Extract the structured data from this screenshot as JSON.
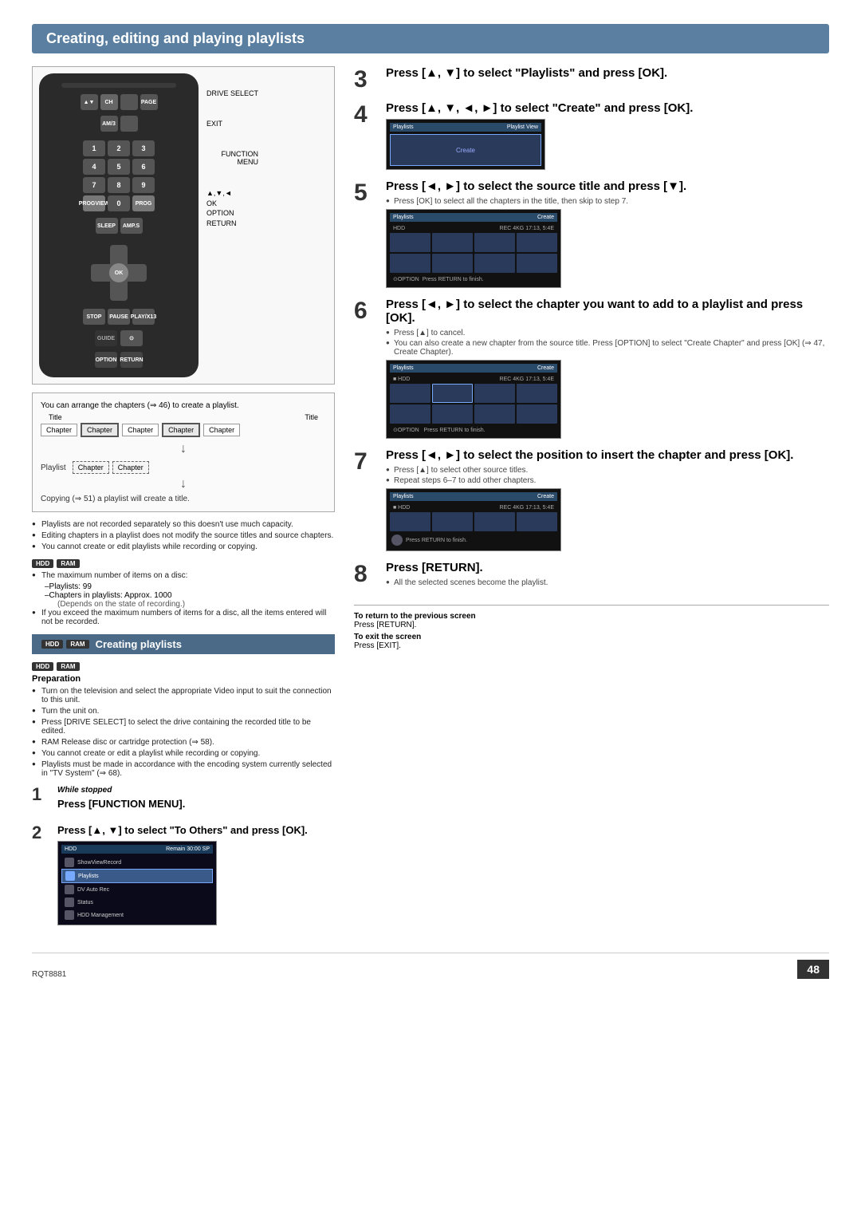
{
  "page": {
    "title": "Creating, editing and playing playlists",
    "page_number": "48",
    "doc_code": "RQT8881"
  },
  "sections": {
    "creating_playlists": {
      "header": "Creating playlists",
      "badges": [
        "HDD",
        "RAM"
      ],
      "preparation_title": "Preparation",
      "prep_notes": [
        "Turn on the television and select the appropriate Video input to suit the connection to this unit.",
        "Turn the unit on.",
        "Press [DRIVE SELECT] to select the drive containing the recorded title to be edited.",
        "RAM Release disc or cartridge protection (⇒ 58).",
        "You cannot create or edit a playlist while recording or copying.",
        "Playlists must be made in accordance with the encoding system currently selected in \"TV System\" (⇒ 68)."
      ]
    },
    "steps": [
      {
        "num": "1",
        "context": "While stopped",
        "text": "Press [FUNCTION MENU]."
      },
      {
        "num": "2",
        "text": "Press [▲, ▼] to select \"To Others\" and press [OK]."
      },
      {
        "num": "3",
        "text": "Press [▲, ▼] to select \"Playlists\" and press [OK]."
      },
      {
        "num": "4",
        "text": "Press [▲, ▼, ◄, ►] to select \"Create\" and press [OK]."
      },
      {
        "num": "5",
        "text": "Press [◄, ►] to select the source title and press [▼].",
        "notes": [
          "Press [OK] to select all the chapters in the title, then skip to step 7."
        ]
      },
      {
        "num": "6",
        "text": "Press [◄, ►] to select the chapter you want to add to a playlist and press [OK].",
        "notes": [
          "Press [▲] to cancel.",
          "You can also create a new chapter from the source title. Press [OPTION] to select \"Create Chapter\" and press [OK] (⇒ 47, Create Chapter)."
        ]
      },
      {
        "num": "7",
        "text": "Press [◄, ►] to select the position to insert the chapter and press [OK].",
        "notes": [
          "Press [▲] to select other source titles.",
          "Repeat steps 6–7 to add other chapters."
        ]
      },
      {
        "num": "8",
        "text": "Press [RETURN].",
        "notes": [
          "All the selected scenes become the playlist."
        ]
      }
    ]
  },
  "diagram": {
    "title_labels": [
      "Title",
      "Title"
    ],
    "chapter_row": [
      "Chapter",
      "Chapter",
      "Chapter",
      "Chapter",
      "Chapter"
    ],
    "playlist_label": "Playlist",
    "playlist_chapters": [
      "Chapter",
      "Chapter"
    ],
    "note": "Copying (⇒ 51) a playlist will create a title."
  },
  "general_notes": [
    "Playlists are not recorded separately so this doesn't use much capacity.",
    "Editing chapters in a playlist does not modify the source titles and source chapters.",
    "You cannot create or edit playlists while recording or copying."
  ],
  "hdd_ram_notes": {
    "badges": [
      "HDD",
      "RAM"
    ],
    "items": [
      "The maximum number of items on a disc:",
      "Playlists: 99",
      "Chapters in playlists: Approx. 1000",
      "(Depends on the state of recording.)",
      "If you exceed the maximum numbers of items for a disc, all the items entered will not be recorded."
    ]
  },
  "footer": {
    "return_label": "To return to the previous screen",
    "return_text": "Press [RETURN].",
    "exit_label": "To exit the screen",
    "exit_text": "Press [EXIT]."
  },
  "screens": {
    "function_menu": {
      "header_left": "HDD",
      "header_right": "Remain 30:00 SP",
      "items": [
        "ShowViewRecord",
        "Playlists",
        "DV Auto Rec",
        "Status",
        "HDD Management"
      ],
      "selected": "Playlists"
    },
    "playlist_view": {
      "header_left": "Playlists",
      "header_right": "Playlist View",
      "selected": "Create"
    },
    "create_source": {
      "header": "Create",
      "hdd_label": "HDD"
    }
  }
}
